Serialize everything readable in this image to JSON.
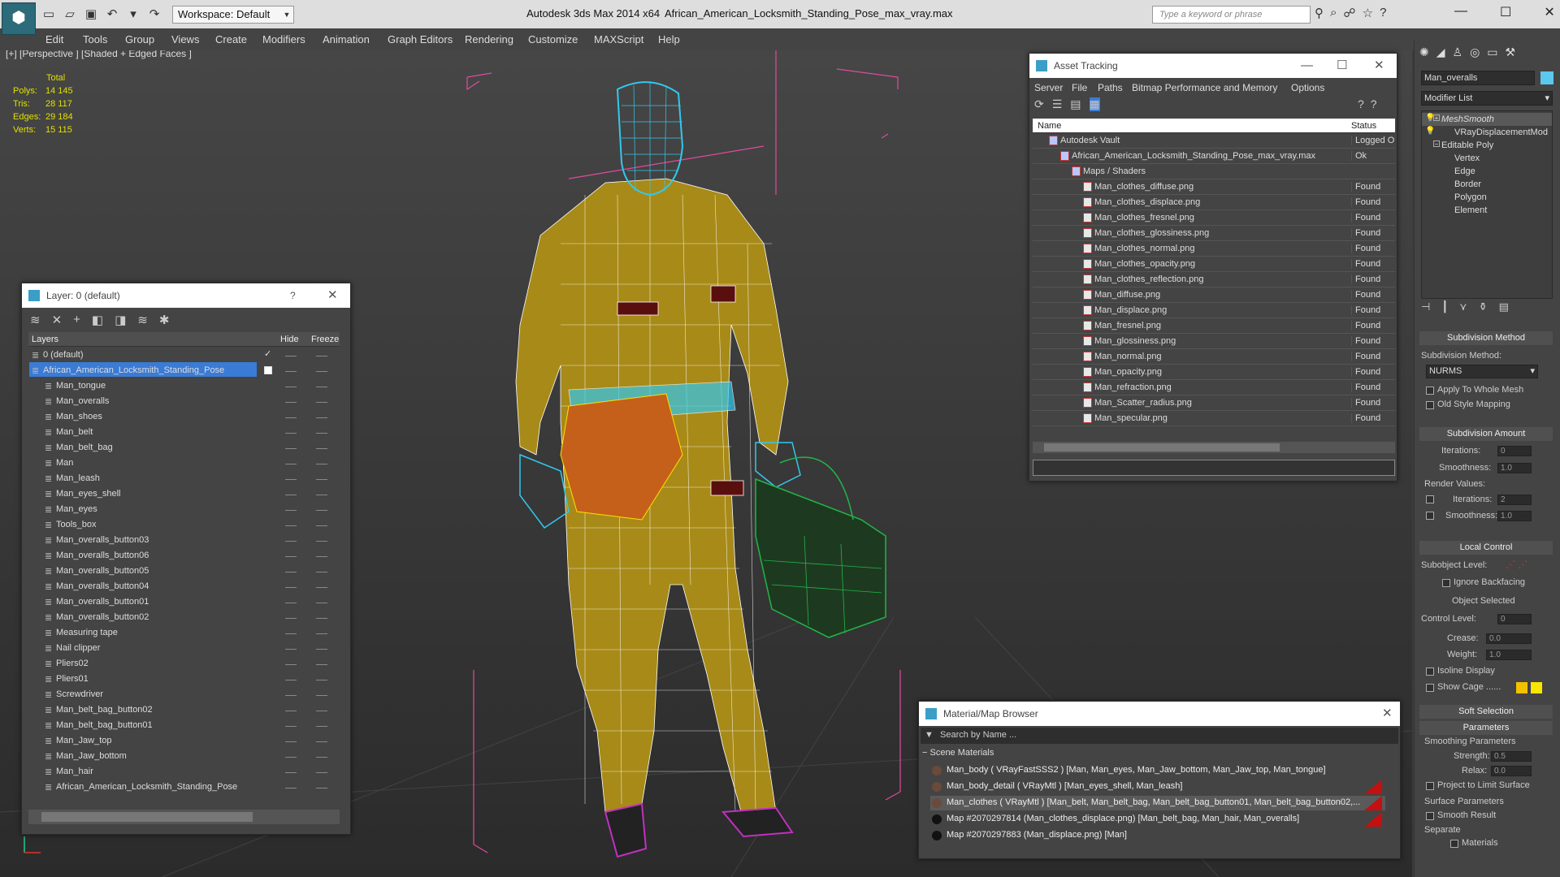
{
  "titlebar": {
    "workspace": "Workspace: Default",
    "app": "Autodesk 3ds Max  2014 x64",
    "file": "African_American_Locksmith_Standing_Pose_max_vray.max",
    "search_placeholder": "Type a keyword or phrase"
  },
  "menu": [
    "Edit",
    "Tools",
    "Group",
    "Views",
    "Create",
    "Modifiers",
    "Animation",
    "Graph Editors",
    "Rendering",
    "Customize",
    "MAXScript",
    "Help"
  ],
  "viewport": {
    "label": "[+] [Perspective ] [Shaded + Edged Faces ]"
  },
  "stats": {
    "total": "Total",
    "polys_label": "Polys:",
    "polys": "14 145",
    "tris_label": "Tris:",
    "tris": "28 117",
    "edges_label": "Edges:",
    "edges": "29 184",
    "verts_label": "Verts:",
    "verts": "15 115"
  },
  "layer_panel": {
    "title": "Layer: 0 (default)",
    "help": "?",
    "col_layers": "Layers",
    "col_hide": "Hide",
    "col_freeze": "Freeze",
    "items": [
      "0 (default)",
      "African_American_Locksmith_Standing_Pose",
      "Man_tongue",
      "Man_overalls",
      "Man_shoes",
      "Man_belt",
      "Man_belt_bag",
      "Man",
      "Man_leash",
      "Man_eyes_shell",
      "Man_eyes",
      "Tools_box",
      "Man_overalls_button03",
      "Man_overalls_button06",
      "Man_overalls_button05",
      "Man_overalls_button04",
      "Man_overalls_button01",
      "Man_overalls_button02",
      "Measuring tape",
      "Nail clipper",
      "Pliers02",
      "Pliers01",
      "Screwdriver",
      "Man_belt_bag_button02",
      "Man_belt_bag_button01",
      "Man_Jaw_top",
      "Man_Jaw_bottom",
      "Man_hair",
      "African_American_Locksmith_Standing_Pose"
    ]
  },
  "asset_panel": {
    "title": "Asset Tracking",
    "menu": [
      "Server",
      "File",
      "Paths",
      "Bitmap Performance and Memory",
      "Options"
    ],
    "col_name": "Name",
    "col_status": "Status",
    "rows": [
      {
        "name": "Autodesk Vault",
        "status": "Logged Ou"
      },
      {
        "name": "African_American_Locksmith_Standing_Pose_max_vray.max",
        "status": "Ok"
      },
      {
        "name": "Maps / Shaders",
        "status": ""
      },
      {
        "name": "Man_clothes_diffuse.png",
        "status": "Found"
      },
      {
        "name": "Man_clothes_displace.png",
        "status": "Found"
      },
      {
        "name": "Man_clothes_fresnel.png",
        "status": "Found"
      },
      {
        "name": "Man_clothes_glossiness.png",
        "status": "Found"
      },
      {
        "name": "Man_clothes_normal.png",
        "status": "Found"
      },
      {
        "name": "Man_clothes_opacity.png",
        "status": "Found"
      },
      {
        "name": "Man_clothes_reflection.png",
        "status": "Found"
      },
      {
        "name": "Man_diffuse.png",
        "status": "Found"
      },
      {
        "name": "Man_displace.png",
        "status": "Found"
      },
      {
        "name": "Man_fresnel.png",
        "status": "Found"
      },
      {
        "name": "Man_glossiness.png",
        "status": "Found"
      },
      {
        "name": "Man_normal.png",
        "status": "Found"
      },
      {
        "name": "Man_opacity.png",
        "status": "Found"
      },
      {
        "name": "Man_refraction.png",
        "status": "Found"
      },
      {
        "name": "Man_Scatter_radius.png",
        "status": "Found"
      },
      {
        "name": "Man_specular.png",
        "status": "Found"
      }
    ]
  },
  "material_panel": {
    "title": "Material/Map Browser",
    "search": "Search by Name ...",
    "section": "Scene Materials",
    "rows": [
      "Man_body  ( VRayFastSSS2 )  [Man, Man_eyes, Man_Jaw_bottom, Man_Jaw_top, Man_tongue]",
      "Man_body_detail  ( VRayMtl )  [Man_eyes_shell, Man_leash]",
      "Man_clothes  ( VRayMtl )  [Man_belt, Man_belt_bag, Man_belt_bag_button01, Man_belt_bag_button02,...",
      "Map #2070297814 (Man_clothes_displace.png)  [Man_belt_bag, Man_hair, Man_overalls]",
      "Map #2070297883 (Man_displace.png)  [Man]"
    ]
  },
  "command_panel": {
    "object_name": "Man_overalls",
    "modifier_list": "Modifier List",
    "stack": [
      "MeshSmooth",
      "VRayDisplacementMod",
      "Editable Poly",
      "Vertex",
      "Edge",
      "Border",
      "Polygon",
      "Element"
    ],
    "subdiv_method_title": "Subdivision Method",
    "subdiv_method_label": "Subdivision Method:",
    "subdiv_method_value": "NURMS",
    "apply_whole": "Apply To Whole Mesh",
    "old_style": "Old Style Mapping",
    "subdiv_amount_title": "Subdivision Amount",
    "iterations_label": "Iterations:",
    "iterations": "0",
    "smoothness_label": "Smoothness:",
    "smoothness": "1.0",
    "render_values": "Render Values:",
    "r_iterations_label": "Iterations:",
    "r_iterations": "2",
    "r_smoothness_label": "Smoothness:",
    "r_smoothness": "1.0",
    "local_control_title": "Local Control",
    "subobject_level": "Subobject Level:",
    "ignore_backfacing": "Ignore Backfacing",
    "object_selected": "Object Selected",
    "control_level_label": "Control Level:",
    "control_level": "0",
    "crease_label": "Crease:",
    "crease": "0.0",
    "weight_label": "Weight:",
    "weight": "1.0",
    "isoline": "Isoline Display",
    "show_cage": "Show Cage ......",
    "soft_selection": "Soft Selection",
    "parameters": "Parameters",
    "smoothing_params": "Smoothing Parameters",
    "strength_label": "Strength:",
    "strength": "0.5",
    "relax_label": "Relax:",
    "relax": "0.0",
    "project_limit": "Project to Limit Surface",
    "surface_params": "Surface Parameters",
    "smooth_result": "Smooth Result",
    "separate": "Separate",
    "materials": "Materials"
  },
  "colors": {
    "overalls": "#a88a18",
    "skin_wire": "#33c8ee",
    "toolbox": "#22b548",
    "shoes": "#c030c0",
    "box_lines": "#e04aa0"
  }
}
